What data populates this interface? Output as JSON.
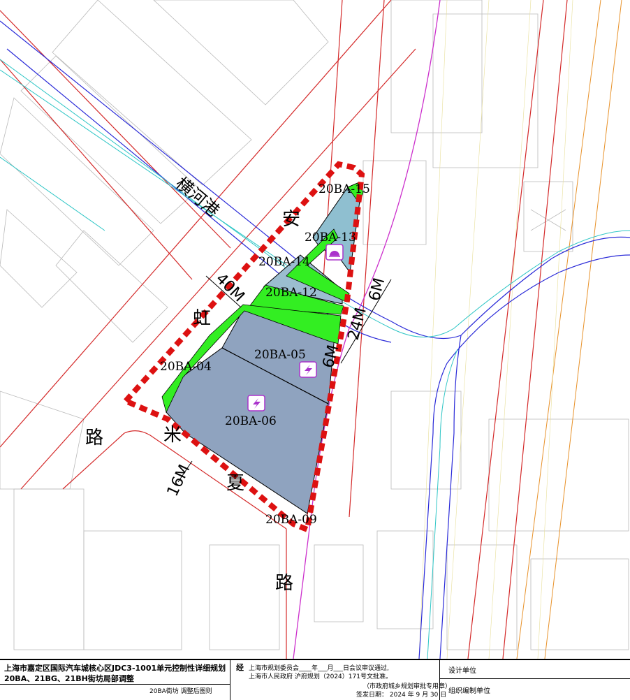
{
  "map": {
    "streets": {
      "anhong_road_chars": [
        "安",
        "虹",
        "路"
      ],
      "hengheng_river": "横河港",
      "mixia_road_chars": [
        "米",
        "夏",
        "路"
      ]
    },
    "widths": {
      "anhong": "40M",
      "mixia": "16M",
      "east_a": "6M",
      "east_b": "24M",
      "east_c": "6M"
    },
    "parcels": {
      "p15": "20BA-15",
      "p13": "20BA-13",
      "p14": "20BA-14",
      "p12": "20BA-12",
      "p05": "20BA-05",
      "p04": "20BA-04",
      "p06": "20BA-06",
      "p09": "20BA-09"
    },
    "icons": [
      "substation-icon",
      "power-icon",
      "power-icon"
    ],
    "colors": {
      "parcel_fill": "#8fa3bf",
      "green_space": "#33ee22",
      "boundary": "#dd1111",
      "road_red": "#d42a2a",
      "river_blue": "#2a2ad8",
      "cyan_line": "#2fc6c6",
      "magenta_line": "#cc2fcc",
      "orange_line": "#e8922a"
    }
  },
  "titleblock": {
    "title_line1": "上海市嘉定区国际汽车城核心区JDC3-1001单元控制性详细规划",
    "title_line2": "20BA、21BG、21BH街坊局部调整",
    "subtitle": "20BA街坊 调整后图则",
    "approve_prefix": "经",
    "approve_line1": "上海市规划委员会____年___月___日会议审议通过,",
    "approve_line2": "上海市人民政府        沪府规划（2024）171号文批准。",
    "seal_note": "（市政府城乡规划审批专用章）",
    "sign_date": "签发日期：  2024  年  9  月  30  日",
    "design_unit": "设计单位",
    "compile_unit": "组织编制单位"
  }
}
